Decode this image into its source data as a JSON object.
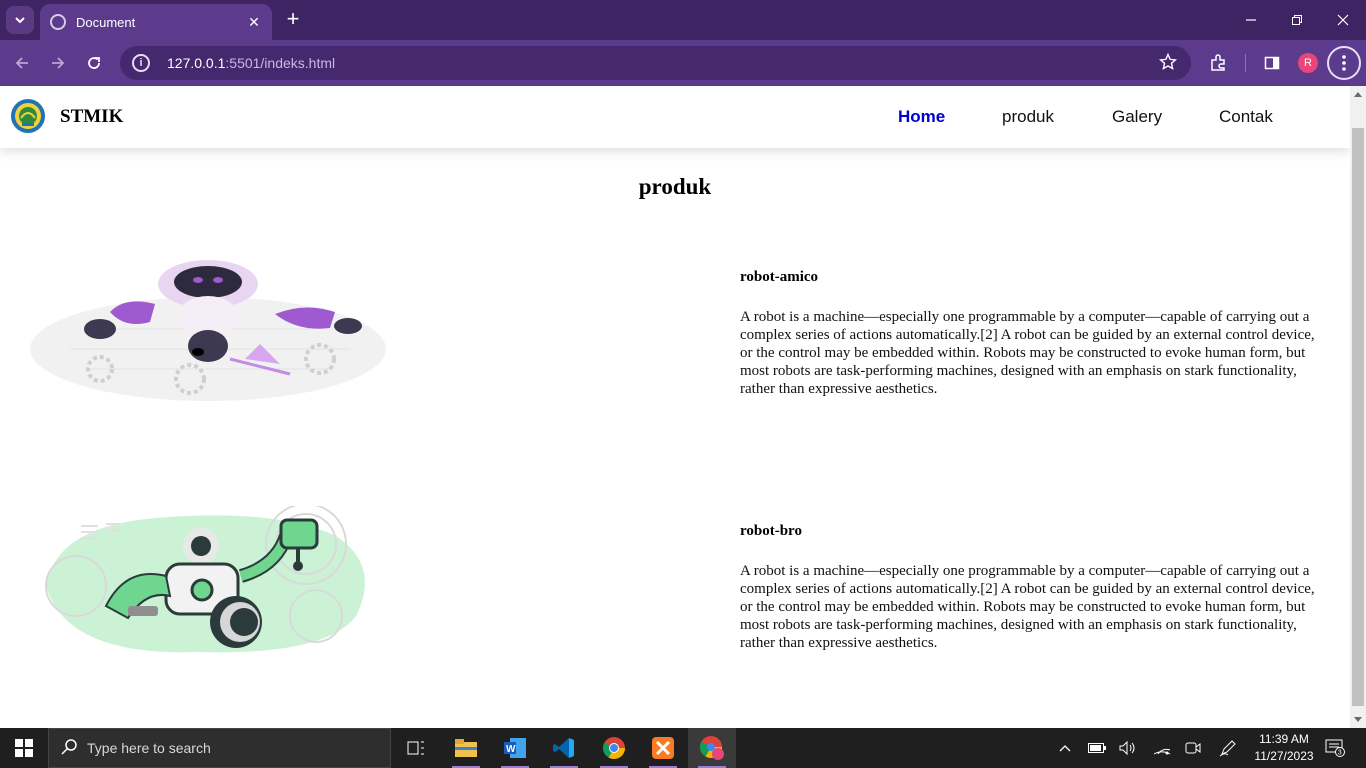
{
  "browser": {
    "tab_title": "Document",
    "url_host": "127.0.0.1",
    "url_rest": ":5501/indeks.html",
    "profile_initial": "R"
  },
  "site": {
    "brand": "STMIK",
    "nav": [
      {
        "label": "Home",
        "active": true
      },
      {
        "label": "produk",
        "active": false
      },
      {
        "label": "Galery",
        "active": false
      },
      {
        "label": "Contak",
        "active": false
      }
    ],
    "heading": "produk",
    "products": [
      {
        "title": "robot-amico",
        "description": "A robot is a machine—especially one programmable by a computer—capable of carrying out a complex series of actions automatically.[2] A robot can be guided by an external control device, or the control may be embedded within. Robots may be constructed to evoke human form, but most robots are task-performing machines, designed with an emphasis on stark functionality, rather than expressive aesthetics."
      },
      {
        "title": "robot-bro",
        "description": "A robot is a machine—especially one programmable by a computer—capable of carrying out a complex series of actions automatically.[2] A robot can be guided by an external control device, or the control may be embedded within. Robots may be constructed to evoke human form, but most robots are task-performing machines, designed with an emphasis on stark functionality, rather than expressive aesthetics."
      }
    ]
  },
  "taskbar": {
    "search_placeholder": "Type here to search",
    "time": "11:39 AM",
    "date": "11/27/2023",
    "notification_count": "3"
  },
  "colors": {
    "browser_frame": "#3f2463",
    "browser_toolbar": "#5c3a8c",
    "nav_active": "#0000cc",
    "robot_amico_accent": "#a05ad0",
    "robot_bro_accent": "#6fd68f"
  },
  "icons": [
    "tab-search-icon",
    "globe-icon",
    "close-icon",
    "plus-icon",
    "minimize-icon",
    "restore-icon",
    "back-icon",
    "forward-icon",
    "reload-icon",
    "info-icon",
    "star-icon",
    "extensions-icon",
    "sidepanel-icon",
    "kebab-menu-icon",
    "windows-icon",
    "search-icon",
    "taskview-icon",
    "file-explorer-icon",
    "word-icon",
    "vscode-icon",
    "chrome-icon",
    "xampp-icon",
    "chevron-up-icon",
    "battery-icon",
    "volume-icon",
    "wifi-icon",
    "meet-icon",
    "pen-icon",
    "notification-icon"
  ]
}
